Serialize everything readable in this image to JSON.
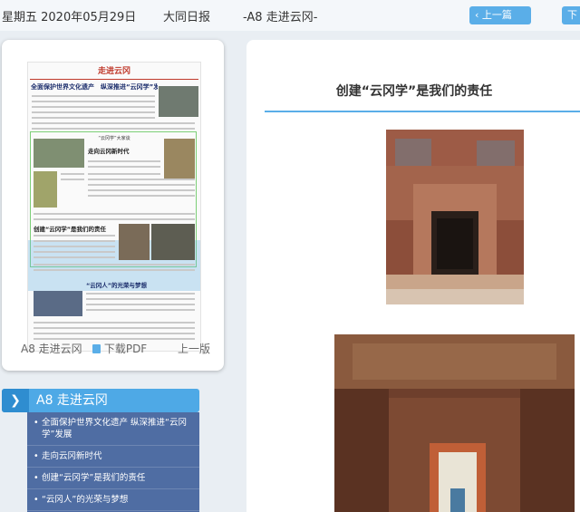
{
  "header": {
    "date": "星期五 2020年05月29日",
    "paper": "大同日报",
    "page": "-A8 走进云冈-",
    "prev_label": "上一篇",
    "next_label": "下"
  },
  "thumbnail": {
    "masthead": "走进云冈",
    "headline": "全面保护世界文化遗产　纵深推进“云冈学”发展",
    "section_title": "走向云冈新时代",
    "box_label": "“云冈学”大家谈",
    "article_title": "创建“云冈学”是我们的责任",
    "bottom_title": "“云冈人”的光荣与梦想",
    "page_label": "A8 走进云冈",
    "download_label": "下载PDF",
    "prev_page": "上一版"
  },
  "section": {
    "label": "A8  走进云冈",
    "items": [
      "全面保护世界文化遗产 纵深推进“云冈学”发展",
      "走向云冈新时代",
      "创建“云冈学”是我们的责任",
      "“云冈人”的光荣与梦想"
    ]
  },
  "article": {
    "title": "创建“云冈学”是我们的责任"
  }
}
